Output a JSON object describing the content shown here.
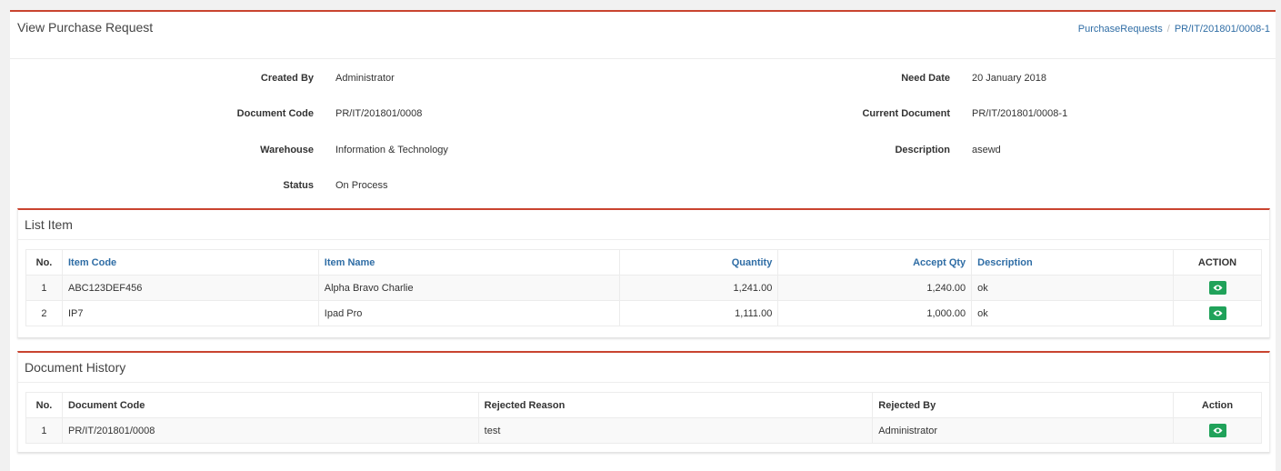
{
  "header": {
    "title": "View Purchase Request",
    "breadcrumb": [
      "PurchaseRequests",
      "PR/IT/201801/0008-1"
    ],
    "breadcrumb_sep": "/"
  },
  "info": {
    "created_by_label": "Created By",
    "created_by": "Administrator",
    "doc_code_label": "Document Code",
    "doc_code": "PR/IT/201801/0008",
    "warehouse_label": "Warehouse",
    "warehouse": "Information & Technology",
    "status_label": "Status",
    "status": "On Process",
    "need_date_label": "Need Date",
    "need_date": "20 January 2018",
    "current_doc_label": "Current Document",
    "current_doc": "PR/IT/201801/0008-1",
    "description_label": "Description",
    "description": "asewd"
  },
  "list_item": {
    "title": "List Item",
    "columns": [
      "No.",
      "Item Code",
      "Item Name",
      "Quantity",
      "Accept Qty",
      "Description",
      "ACTION"
    ],
    "rows": [
      {
        "no": "1",
        "code": "ABC123DEF456",
        "name": "Alpha Bravo Charlie",
        "qty": "1,241.00",
        "accept": "1,240.00",
        "desc": "ok"
      },
      {
        "no": "2",
        "code": "IP7",
        "name": "Ipad Pro",
        "qty": "1,111.00",
        "accept": "1,000.00",
        "desc": "ok"
      }
    ]
  },
  "history": {
    "title": "Document History",
    "columns": [
      "No.",
      "Document Code",
      "Rejected Reason",
      "Rejected By",
      "Action"
    ],
    "rows": [
      {
        "no": "1",
        "code": "PR/IT/201801/0008",
        "reason": "test",
        "by": "Administrator"
      }
    ]
  },
  "colors": {
    "accent": "#c9442f",
    "link": "#2f6da5",
    "button": "#20a25a"
  },
  "icons": {
    "view": "eye-icon"
  }
}
